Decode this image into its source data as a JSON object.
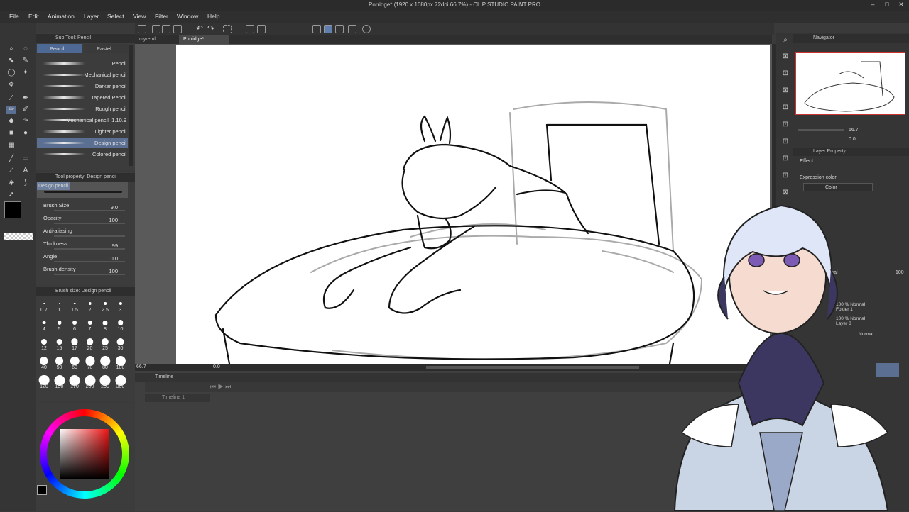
{
  "window": {
    "title": "Porridge* (1920 x 1080px 72dpi 66.7%) - CLIP STUDIO PAINT PRO"
  },
  "menu": [
    "File",
    "Edit",
    "Animation",
    "Layer",
    "Select",
    "View",
    "Filter",
    "Window",
    "Help"
  ],
  "tabs": [
    {
      "label": "myreml"
    },
    {
      "label": "Porridge*"
    }
  ],
  "subtool": {
    "header": "Sub Tool: Pencil",
    "groups": [
      "Pencil",
      "Pastel"
    ],
    "brushes": [
      "Pencil",
      "Mechanical pencil",
      "Darker pencil",
      "Tapered Pencil",
      "Rough pencil",
      "Mechanical pencil_1.10.9",
      "Lighter pencil",
      "Design pencil",
      "Colored pencil"
    ],
    "selected": "Design pencil"
  },
  "tool_property": {
    "header": "Tool property: Design pencil",
    "preset": "Design pencil",
    "props": [
      {
        "label": "Brush Size",
        "value": "9.0"
      },
      {
        "label": "Opacity",
        "value": "100"
      },
      {
        "label": "Anti-aliasing",
        "value": ""
      },
      {
        "label": "Thickness",
        "value": "99"
      },
      {
        "label": "Angle",
        "value": "0.0"
      },
      {
        "label": "Brush density",
        "value": "100"
      }
    ]
  },
  "brush_size": {
    "header": "Brush size: Design pencil",
    "sizes": [
      "0.7",
      "1",
      "1.5",
      "2",
      "2.5",
      "3",
      "4",
      "5",
      "6",
      "7",
      "8",
      "10",
      "12",
      "15",
      "17",
      "20",
      "25",
      "30",
      "40",
      "50",
      "60",
      "70",
      "80",
      "100",
      "120",
      "150",
      "170",
      "200",
      "250",
      "300"
    ]
  },
  "status": {
    "zoom": "66.7",
    "angle": "0.0"
  },
  "timeline": {
    "header": "Timeline",
    "name": "Timeline 1"
  },
  "navigator": {
    "header": "Navigator",
    "zoom": "66.7",
    "angle": "0.0"
  },
  "layer_property": {
    "header": "Layer Property",
    "effect_label": "Effect",
    "expression_label": "Expression color",
    "expression_value": "Color"
  },
  "layers": {
    "blend": "Normal",
    "opacity": "100",
    "items": [
      {
        "meta": "100 % Normal",
        "name": "Folder 1"
      },
      {
        "meta": "100 % Normal",
        "name": "Layer 8"
      },
      {
        "meta": "Normal",
        "name": ""
      }
    ]
  },
  "colors": {
    "main": "#000000",
    "sub": "#000000",
    "accent": "#8ea7c8"
  },
  "icons": [
    "pencil-icon",
    "zoom-icon",
    "move-icon",
    "eyedropper-icon",
    "eraser-icon",
    "fill-icon",
    "text-icon",
    "undo-icon",
    "redo-icon",
    "navigator-icon"
  ]
}
